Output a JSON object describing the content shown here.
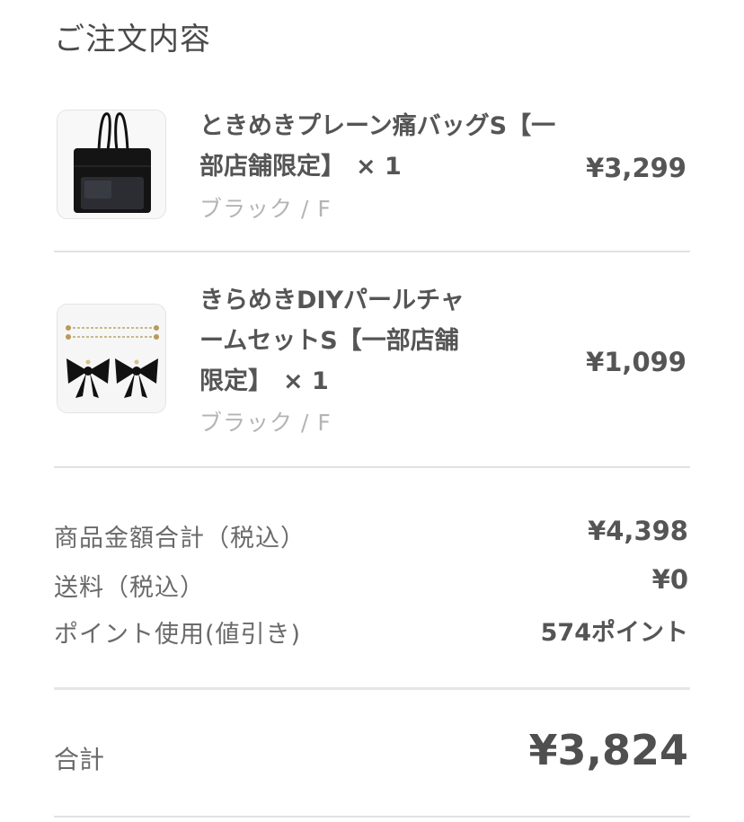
{
  "header": {
    "title": "ご注文内容"
  },
  "items": [
    {
      "name": "ときめきプレーン痛バッグS【一部店舗限定】",
      "quantity": "× 1",
      "variant": "ブラック / F",
      "price": "¥3,299",
      "image": "black-tote-bag-image"
    },
    {
      "name": "きらめきDIYパールチャームセットS【一部店舗限定】",
      "quantity": "× 1",
      "variant": "ブラック / F",
      "price": "¥1,099",
      "image": "pearl-charm-ribbon-set-image"
    }
  ],
  "summary": {
    "subtotal_label": "商品金額合計（税込）",
    "subtotal_value": "¥4,398",
    "shipping_label": "送料（税込）",
    "shipping_value": "¥0",
    "points_label": "ポイント使用(値引き)",
    "points_value": "574ポイント"
  },
  "total": {
    "label": "合計",
    "value": "¥3,824"
  },
  "colors": {
    "text": "#4a4a4a",
    "muted": "#b4b4b4",
    "divider": "#e2e2e2"
  }
}
